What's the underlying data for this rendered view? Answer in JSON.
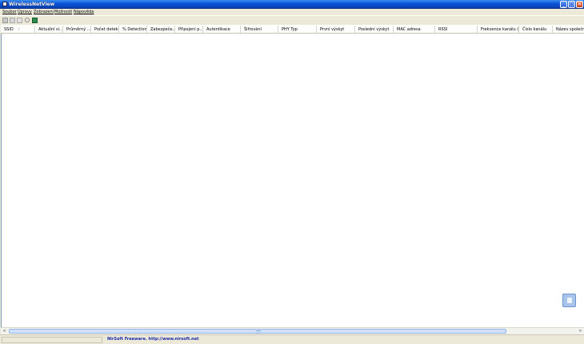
{
  "window": {
    "title": "WirelessNetView"
  },
  "title_buttons": {
    "minimize": "_",
    "maximize": "□",
    "close": "✕"
  },
  "menu": [
    "Soubor",
    "Úpravy",
    "Zobrazení",
    "Možnosti",
    "Nápověda"
  ],
  "toolbar": {
    "icons": [
      "save-icon",
      "copy-icon",
      "html-report-icon",
      "find-icon",
      "exit-icon"
    ]
  },
  "columns": [
    "SSID",
    "Aktuální si...",
    "Průměrný ...",
    "Počet detekcí",
    "% Detection",
    "Zabezpeče...",
    "Připojení p...",
    "Autentikace",
    "Šifrování",
    "PHY Typ",
    "První výskyt",
    "Poslední výskyt",
    "MAC adresa",
    "RSSI",
    "Frekvence kanálu (...",
    "Číslo kanálu",
    "Název společnosti"
  ],
  "sort_indicator": "/",
  "status": {
    "link_text": "NirSoft Freeware.  http://www.nirsoft.net"
  },
  "scrollbar": {
    "left_arrow": "<",
    "right_arrow": ">"
  },
  "colors": {
    "titlebar": "#0a55d8",
    "chrome": "#ece9d8",
    "list_background": "#ffffff",
    "status_link": "#1d2aa8"
  }
}
